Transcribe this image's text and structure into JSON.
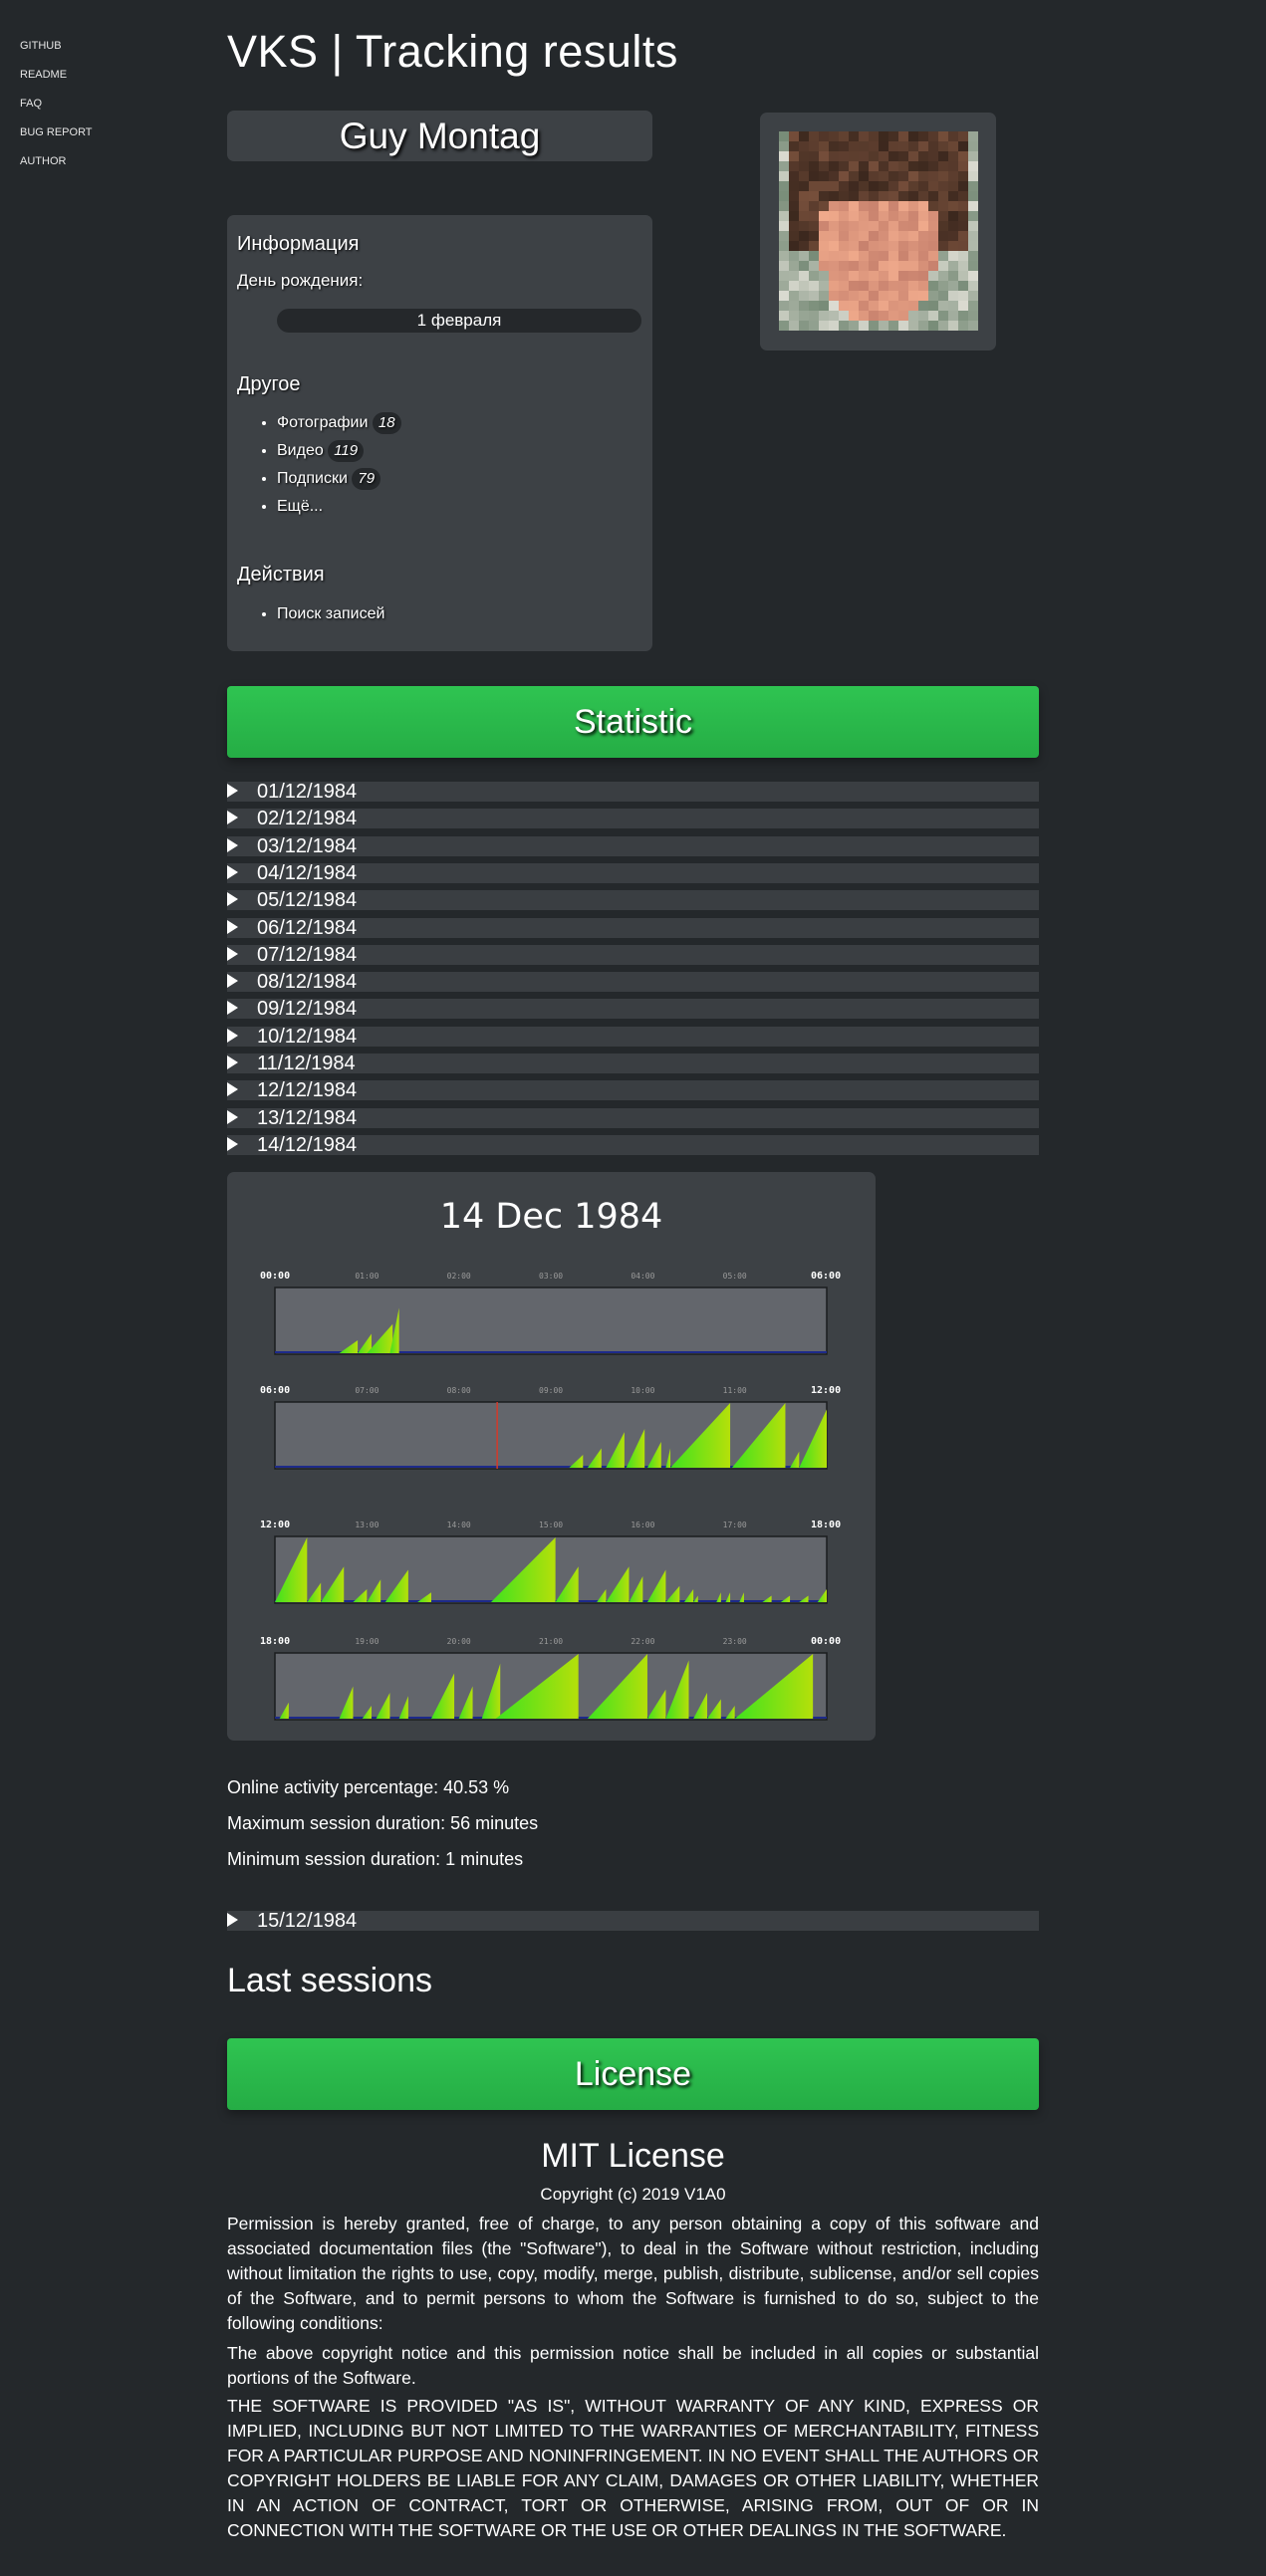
{
  "sidebar": {
    "items": [
      "GITHUB",
      "README",
      "FAQ",
      "BUG REPORT",
      "AUTHOR"
    ]
  },
  "page_title": "VKS | Tracking results",
  "profile": {
    "name": "Guy Montag"
  },
  "info": {
    "heading": "Информация",
    "birthday_label": "День рождения:",
    "birthday_value": "1 февраля",
    "other_heading": "Другое",
    "other_items": [
      {
        "label": "Фотографии",
        "count": "18"
      },
      {
        "label": "Видео",
        "count": "119"
      },
      {
        "label": "Подписки",
        "count": "79"
      },
      {
        "label": "Ещё...",
        "count": ""
      }
    ],
    "actions_heading": "Действия",
    "actions": [
      "Поиск записей"
    ]
  },
  "statistic_button": "Statistic",
  "days": [
    "01/12/1984",
    "02/12/1984",
    "03/12/1984",
    "04/12/1984",
    "05/12/1984",
    "06/12/1984",
    "07/12/1984",
    "08/12/1984",
    "09/12/1984",
    "10/12/1984",
    "11/12/1984",
    "12/12/1984",
    "13/12/1984",
    "14/12/1984"
  ],
  "day_after": "15/12/1984",
  "chart_data": {
    "type": "area",
    "title": "14 Dec 1984",
    "rows": [
      {
        "start": "00:00",
        "end": "06:00",
        "ticks": [
          "01:00",
          "02:00",
          "03:00",
          "04:00",
          "05:00"
        ],
        "peaks": [
          [
            0.7,
            0.9,
            0.2
          ],
          [
            0.9,
            1.05,
            0.3
          ],
          [
            1.0,
            1.28,
            0.45
          ],
          [
            1.25,
            1.35,
            0.7
          ]
        ],
        "marker": null
      },
      {
        "start": "06:00",
        "end": "12:00",
        "ticks": [
          "07:00",
          "08:00",
          "09:00",
          "10:00",
          "11:00"
        ],
        "peaks": [
          [
            9.2,
            9.35,
            0.2
          ],
          [
            9.4,
            9.55,
            0.3
          ],
          [
            9.6,
            9.8,
            0.55
          ],
          [
            9.82,
            10.02,
            0.6
          ],
          [
            10.05,
            10.2,
            0.4
          ],
          [
            10.25,
            10.3,
            0.3
          ],
          [
            10.3,
            10.95,
            1.0
          ],
          [
            10.97,
            11.55,
            1.0
          ],
          [
            11.6,
            11.7,
            0.25
          ],
          [
            11.75,
            11.85,
            0.15
          ],
          [
            11.7,
            12.0,
            0.9
          ]
        ],
        "marker": "08:25"
      },
      {
        "start": "12:00",
        "end": "18:00",
        "ticks": [
          "13:00",
          "14:00",
          "15:00",
          "16:00",
          "17:00"
        ],
        "peaks": [
          [
            12.0,
            12.35,
            1.0
          ],
          [
            12.35,
            12.5,
            0.3
          ],
          [
            12.5,
            12.75,
            0.55
          ],
          [
            12.85,
            13.0,
            0.2
          ],
          [
            13.0,
            13.15,
            0.35
          ],
          [
            13.2,
            13.45,
            0.5
          ],
          [
            13.55,
            13.7,
            0.15
          ],
          [
            14.35,
            15.05,
            1.0
          ],
          [
            15.05,
            15.3,
            0.55
          ],
          [
            15.5,
            15.6,
            0.2
          ],
          [
            15.6,
            15.85,
            0.55
          ],
          [
            15.85,
            16.0,
            0.4
          ],
          [
            16.05,
            16.25,
            0.5
          ],
          [
            16.25,
            16.4,
            0.25
          ],
          [
            16.45,
            16.55,
            0.2
          ],
          [
            16.55,
            16.6,
            0.1
          ],
          [
            16.8,
            16.85,
            0.15
          ],
          [
            16.9,
            16.95,
            0.15
          ],
          [
            17.05,
            17.1,
            0.15
          ],
          [
            17.3,
            17.4,
            0.1
          ],
          [
            17.5,
            17.6,
            0.1
          ],
          [
            17.7,
            17.8,
            0.1
          ],
          [
            17.9,
            18.0,
            0.2
          ]
        ],
        "marker": null
      },
      {
        "start": "18:00",
        "end": "00:00",
        "ticks": [
          "19:00",
          "20:00",
          "21:00",
          "22:00",
          "23:00"
        ],
        "peaks": [
          [
            18.05,
            18.15,
            0.25
          ],
          [
            18.7,
            18.85,
            0.5
          ],
          [
            18.95,
            19.05,
            0.2
          ],
          [
            19.1,
            19.25,
            0.4
          ],
          [
            19.35,
            19.45,
            0.35
          ],
          [
            19.7,
            19.95,
            0.7
          ],
          [
            20.0,
            20.15,
            0.5
          ],
          [
            20.25,
            20.45,
            0.85
          ],
          [
            20.4,
            21.3,
            1.0
          ],
          [
            21.4,
            22.05,
            1.0
          ],
          [
            22.05,
            22.25,
            0.45
          ],
          [
            22.25,
            22.5,
            0.9
          ],
          [
            22.55,
            22.7,
            0.4
          ],
          [
            22.7,
            22.85,
            0.3
          ],
          [
            22.9,
            23.0,
            0.2
          ],
          [
            23.0,
            23.85,
            1.0
          ]
        ],
        "marker": null
      }
    ]
  },
  "stats": {
    "online": "Online activity percentage: 40.53 %",
    "max": "Maximum session duration: 56 minutes",
    "min": "Minimum session duration: 1 minutes"
  },
  "last_sessions_heading": "Last sessions",
  "license_button": "License",
  "license": {
    "title": "MIT License",
    "copyright": "Copyright (c) 2019 V1A0",
    "p1": "Permission is hereby granted, free of charge, to any person obtaining a copy of this software and associated documentation files (the \"Software\"), to deal in the Software without restriction, including without limitation the rights to use, copy, modify, merge, publish, distribute, sublicense, and/or sell copies of the Software, and to permit persons to whom the Software is furnished to do so, subject to the following conditions:",
    "p2": "The above copyright notice and this permission notice shall be included in all copies or substantial portions of the Software.",
    "p3": "THE SOFTWARE IS PROVIDED \"AS IS\", WITHOUT WARRANTY OF ANY KIND, EXPRESS OR IMPLIED, INCLUDING BUT NOT LIMITED TO THE WARRANTIES OF MERCHANTABILITY, FITNESS FOR A PARTICULAR PURPOSE AND NONINFRINGEMENT. IN NO EVENT SHALL THE AUTHORS OR COPYRIGHT HOLDERS BE LIABLE FOR ANY CLAIM, DAMAGES OR OTHER LIABILITY, WHETHER IN AN ACTION OF CONTRACT, TORT OR OTHERWISE, ARISING FROM, OUT OF OR IN CONNECTION WITH THE SOFTWARE OR THE USE OR OTHER DEALINGS IN THE SOFTWARE."
  },
  "colors": {
    "accent": "#2fc451",
    "background": "#24282b",
    "panel": "#3d4145",
    "activity": "#a7e00a"
  }
}
